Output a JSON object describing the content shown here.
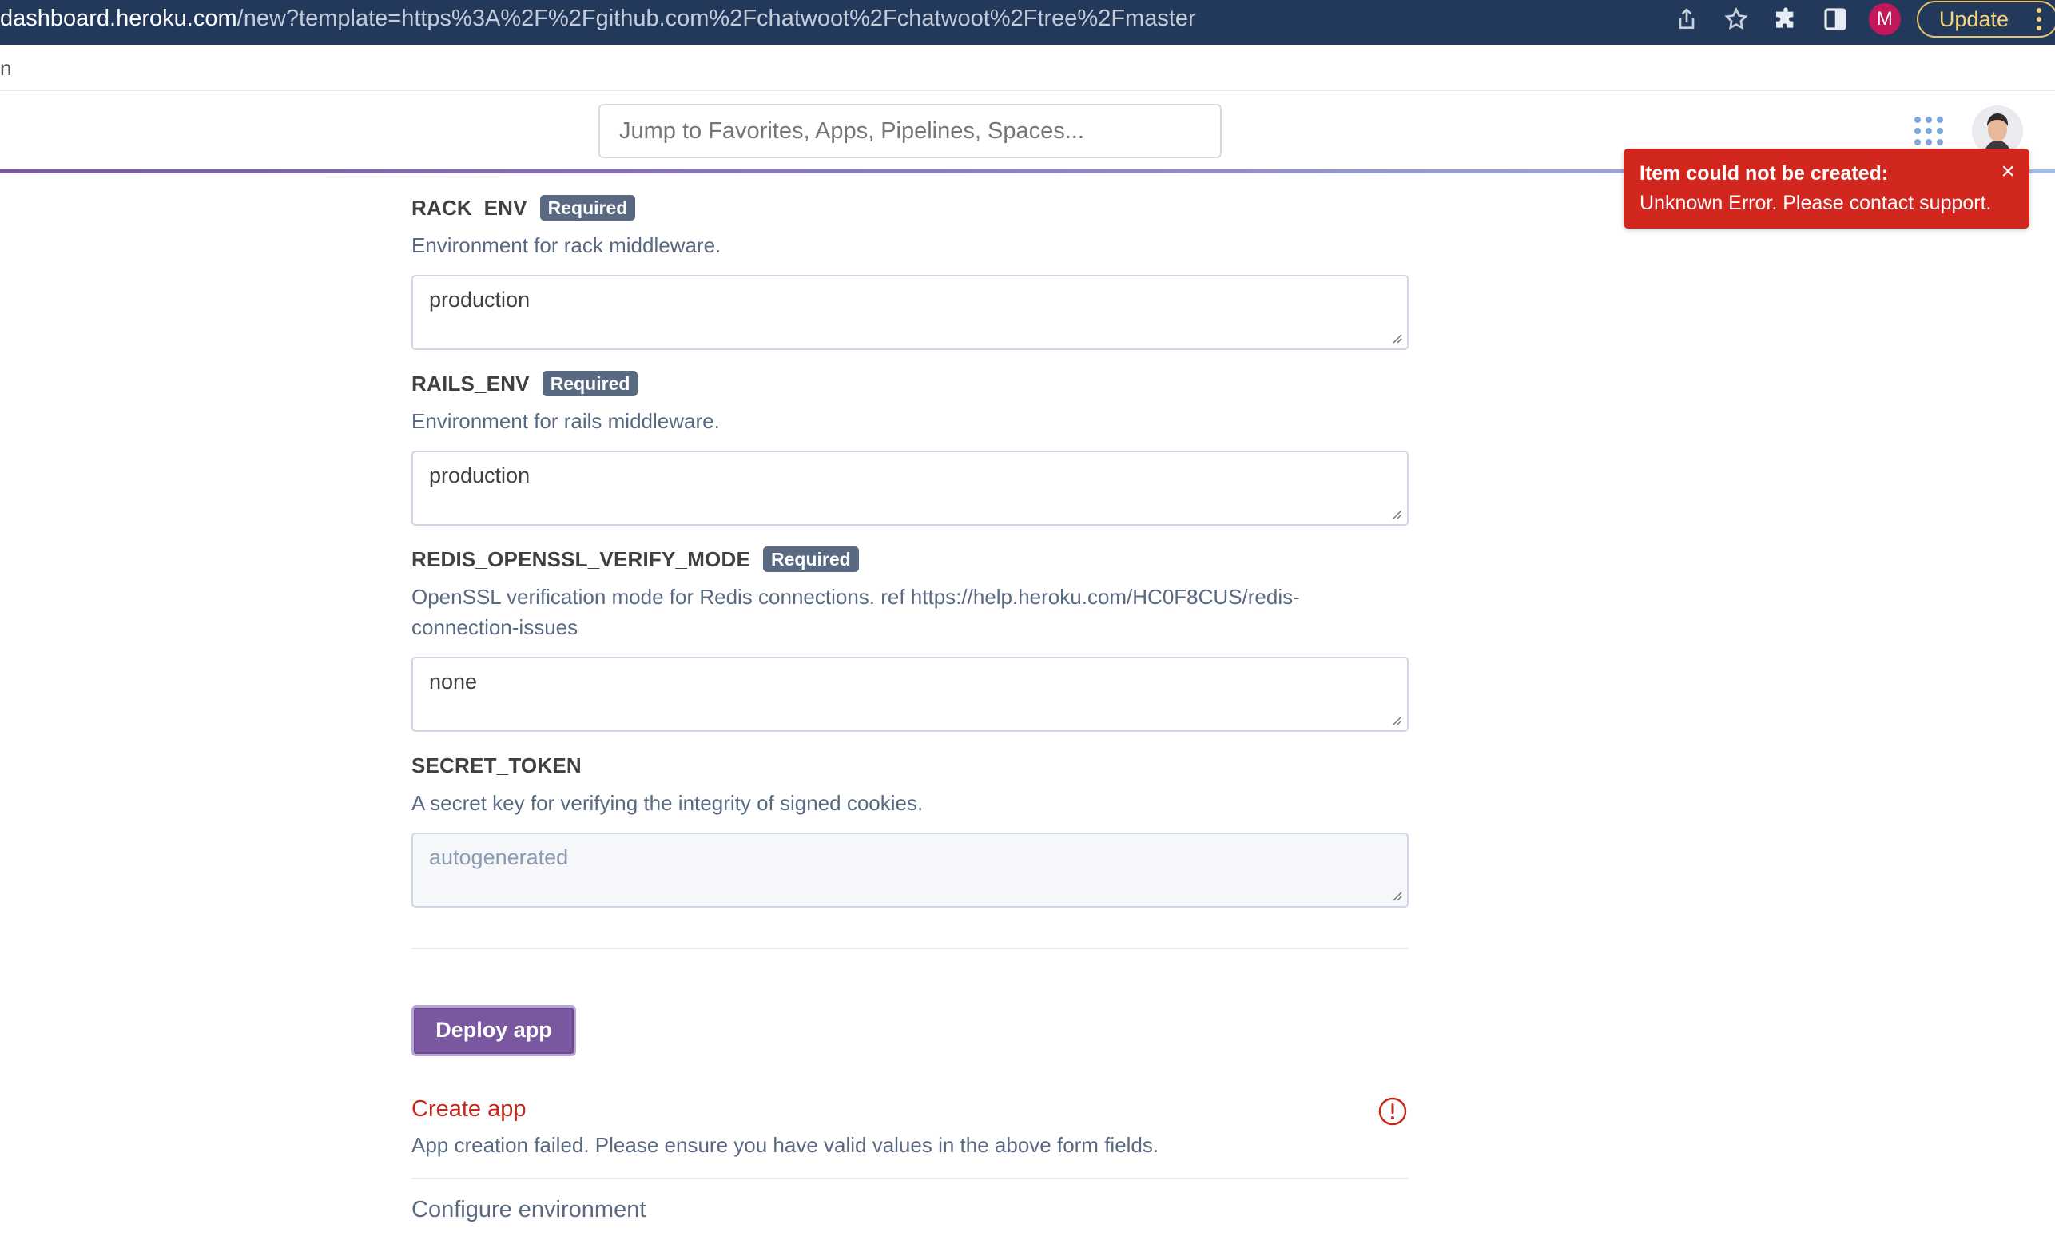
{
  "browser": {
    "url_host": "dashboard.heroku.com",
    "url_path": "/new?template=https%3A%2F%2Fgithub.com%2Fchatwoot%2Fchatwoot%2Ftree%2Fmaster",
    "profile_initial": "M",
    "update_label": "Update",
    "strip_fragment": "n"
  },
  "header": {
    "search_placeholder": "Jump to Favorites, Apps, Pipelines, Spaces..."
  },
  "toast": {
    "title": "Item could not be created:",
    "message": "Unknown Error. Please contact support.",
    "close": "×"
  },
  "fields": [
    {
      "name": "RACK_ENV",
      "badge": "Required",
      "description": "Environment for rack middleware.",
      "value": "production"
    },
    {
      "name": "RAILS_ENV",
      "badge": "Required",
      "description": "Environment for rails middleware.",
      "value": "production"
    },
    {
      "name": "REDIS_OPENSSL_VERIFY_MODE",
      "badge": "Required",
      "description_line1": "OpenSSL verification mode for Redis connections. ref https://help.heroku.com/HC0F8CUS/redis-",
      "description_line2": "connection-issues",
      "value": "none"
    },
    {
      "name": "SECRET_TOKEN",
      "description": "A secret key for verifying the integrity of signed cookies.",
      "placeholder": "autogenerated"
    }
  ],
  "deploy_button": "Deploy app",
  "steps": {
    "create_title": "Create app",
    "create_desc": "App creation failed. Please ensure you have valid values in the above form fields.",
    "configure_title": "Configure environment"
  },
  "colors": {
    "heroku_purple": "#79589f",
    "error_red": "#d2271f",
    "chrome_bar": "#23395b"
  }
}
